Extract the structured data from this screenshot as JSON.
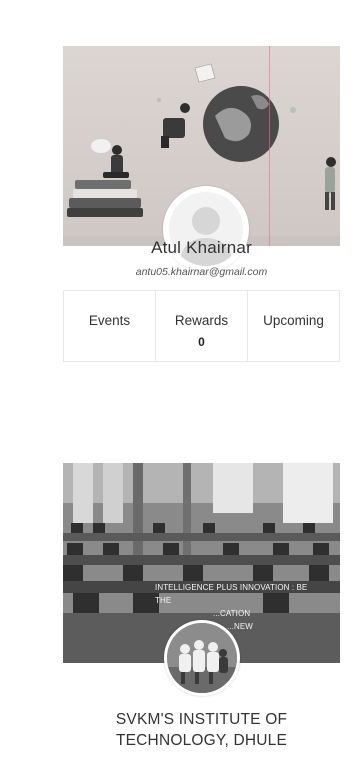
{
  "profile": {
    "name": "Atul Khairnar",
    "email": "antu05.khairnar@gmail.com"
  },
  "stats": [
    {
      "label": "Events",
      "value": ""
    },
    {
      "label": "Rewards",
      "value": "0"
    },
    {
      "label": "Upcoming",
      "value": ""
    }
  ],
  "institute": {
    "banner_lines": [
      "INTELLIGENCE PLUS INNOVATION : BE THE",
      "...CATION",
      "...NEW"
    ],
    "name_line1": "SVKM'S INSTITUTE OF",
    "name_line2": "TECHNOLOGY, DHULE"
  },
  "colors": {
    "cover_bg": "#d4cdca",
    "accent_globe": "#4a4a4a"
  }
}
